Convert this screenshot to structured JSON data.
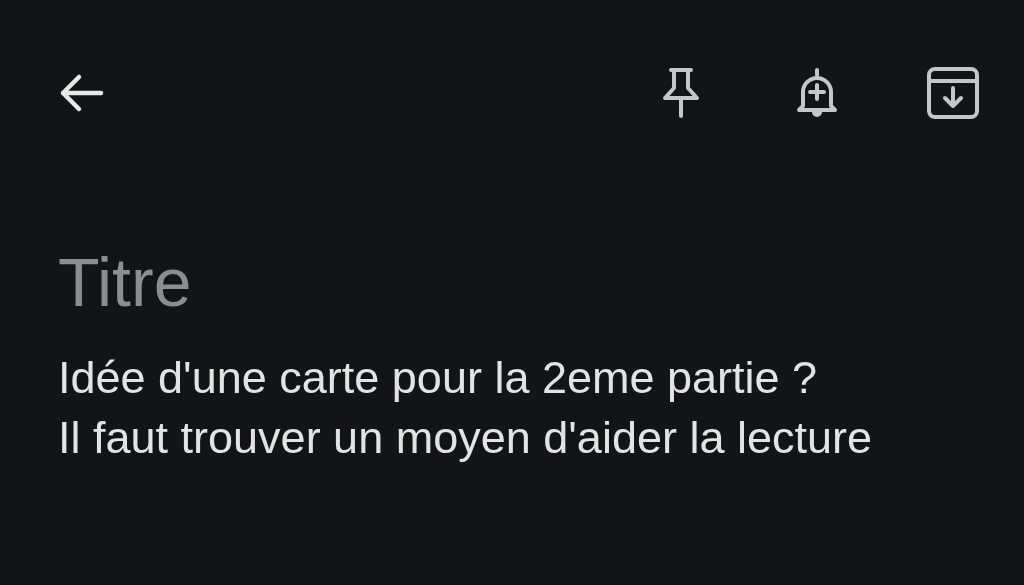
{
  "toolbar": {
    "actions": [
      {
        "kind": "pin"
      },
      {
        "kind": "reminder"
      },
      {
        "kind": "archive"
      }
    ]
  },
  "note": {
    "title": {
      "placeholder": "Titre"
    },
    "body": "Idée d'une carte pour la 2eme partie ?\nIl faut trouver un moyen d'aider la lecture"
  }
}
